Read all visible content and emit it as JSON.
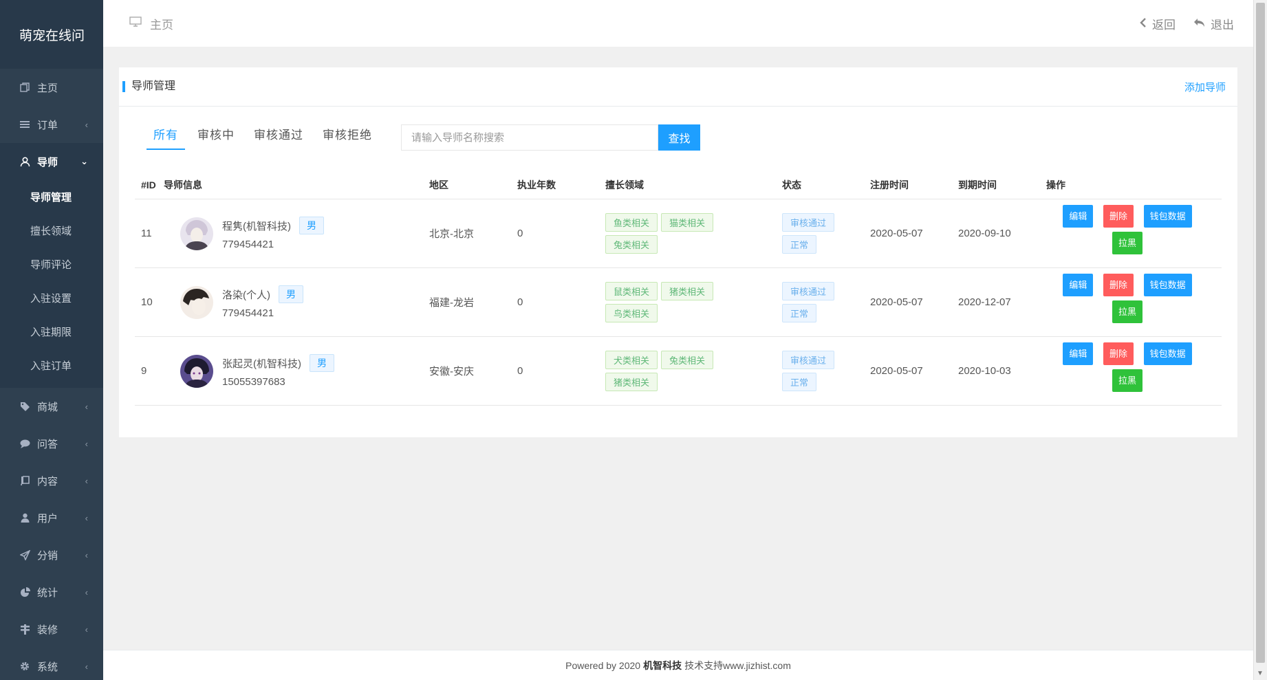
{
  "brand": "萌宠在线问",
  "sidebar": {
    "items": [
      {
        "label": "主页",
        "icon": "copy-icon",
        "expandable": false
      },
      {
        "label": "订单",
        "icon": "list-icon",
        "expandable": true
      },
      {
        "label": "导师",
        "icon": "user-icon",
        "expandable": true,
        "active": true
      },
      {
        "label": "商城",
        "icon": "tag-icon",
        "expandable": true
      },
      {
        "label": "问答",
        "icon": "comment-icon",
        "expandable": true
      },
      {
        "label": "内容",
        "icon": "book-icon",
        "expandable": true
      },
      {
        "label": "用户",
        "icon": "person-icon",
        "expandable": true
      },
      {
        "label": "分销",
        "icon": "send-icon",
        "expandable": true
      },
      {
        "label": "统计",
        "icon": "pie-icon",
        "expandable": true
      },
      {
        "label": "装修",
        "icon": "paint-icon",
        "expandable": true
      },
      {
        "label": "系统",
        "icon": "gear-icon",
        "expandable": true
      }
    ],
    "submenu": [
      "导师管理",
      "擅长领域",
      "导师评论",
      "入驻设置",
      "入驻期限",
      "入驻订单"
    ]
  },
  "topbar": {
    "breadcrumb": "主页",
    "back_label": "返回",
    "logout_label": "退出"
  },
  "card": {
    "title": "导师管理",
    "add_label": "添加导师"
  },
  "filters": {
    "tabs": [
      "所有",
      "审核中",
      "审核通过",
      "审核拒绝"
    ],
    "active_tab": 0,
    "search_placeholder": "请输入导师名称搜索",
    "search_value": "",
    "search_button": "查找"
  },
  "table": {
    "headers": [
      "#ID",
      "导师信息",
      "地区",
      "执业年数",
      "擅长领域",
      "状态",
      "注册时间",
      "到期时间",
      "操作"
    ],
    "rows": [
      {
        "id": "11",
        "name": "程隽(机智科技)",
        "gender": "男",
        "phone": "779454421",
        "region": "北京-北京",
        "years": "0",
        "fields": [
          "鱼类相关",
          "猫类相关",
          "兔类相关"
        ],
        "audit": "审核通过",
        "state": "正常",
        "registered": "2020-05-07",
        "expires": "2020-09-10",
        "avatar_color": "#cfc6d8"
      },
      {
        "id": "10",
        "name": "洛染(个人)",
        "gender": "男",
        "phone": "779454421",
        "region": "福建-龙岩",
        "years": "0",
        "fields": [
          "鼠类相关",
          "猪类相关",
          "鸟类相关"
        ],
        "audit": "审核通过",
        "state": "正常",
        "registered": "2020-05-07",
        "expires": "2020-12-07",
        "avatar_color": "#e7dcd5"
      },
      {
        "id": "9",
        "name": "张起灵(机智科技)",
        "gender": "男",
        "phone": "15055397683",
        "region": "安徽-安庆",
        "years": "0",
        "fields": [
          "犬类相关",
          "兔类相关",
          "猪类相关"
        ],
        "audit": "审核通过",
        "state": "正常",
        "registered": "2020-05-07",
        "expires": "2020-10-03",
        "avatar_color": "#3a3a6a"
      }
    ],
    "actions": {
      "edit": "编辑",
      "delete": "删除",
      "wallet": "钱包数据",
      "block": "拉黑"
    }
  },
  "footer": {
    "prefix": "Powered by 2020",
    "company": "机智科技",
    "suffix": "技术支持www.jizhist.com"
  },
  "colors": {
    "accent": "#1e9fff",
    "sidebar_bg": "#2f4050",
    "danger": "#ff5c5c",
    "success": "#2fc23a"
  }
}
